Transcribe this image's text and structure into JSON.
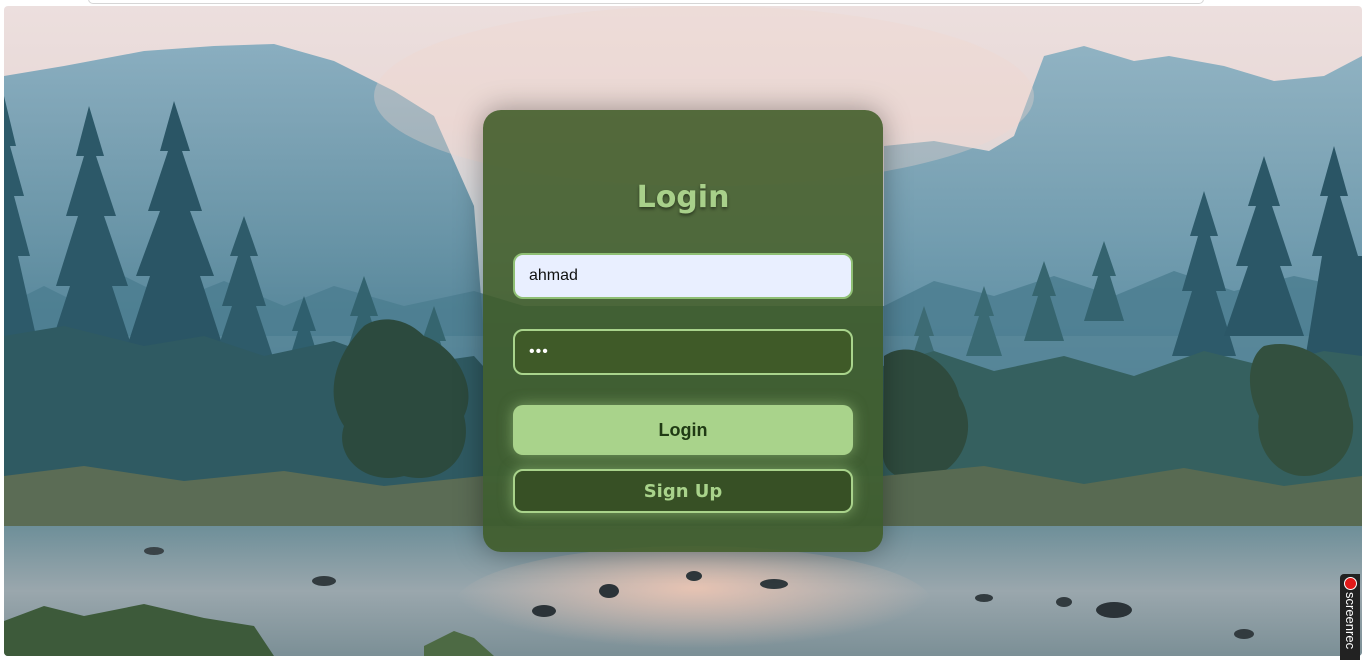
{
  "login": {
    "title": "Login",
    "username_value": "ahmad",
    "password_value": "•••",
    "login_button_label": "Login",
    "signup_button_label": "Sign Up"
  },
  "badge": {
    "text": "screenrec"
  },
  "colors": {
    "card_background": "#3e5a26",
    "accent_green": "#a9d38b",
    "title_green": "#a8d08a",
    "username_field_bg": "#e9efff"
  }
}
